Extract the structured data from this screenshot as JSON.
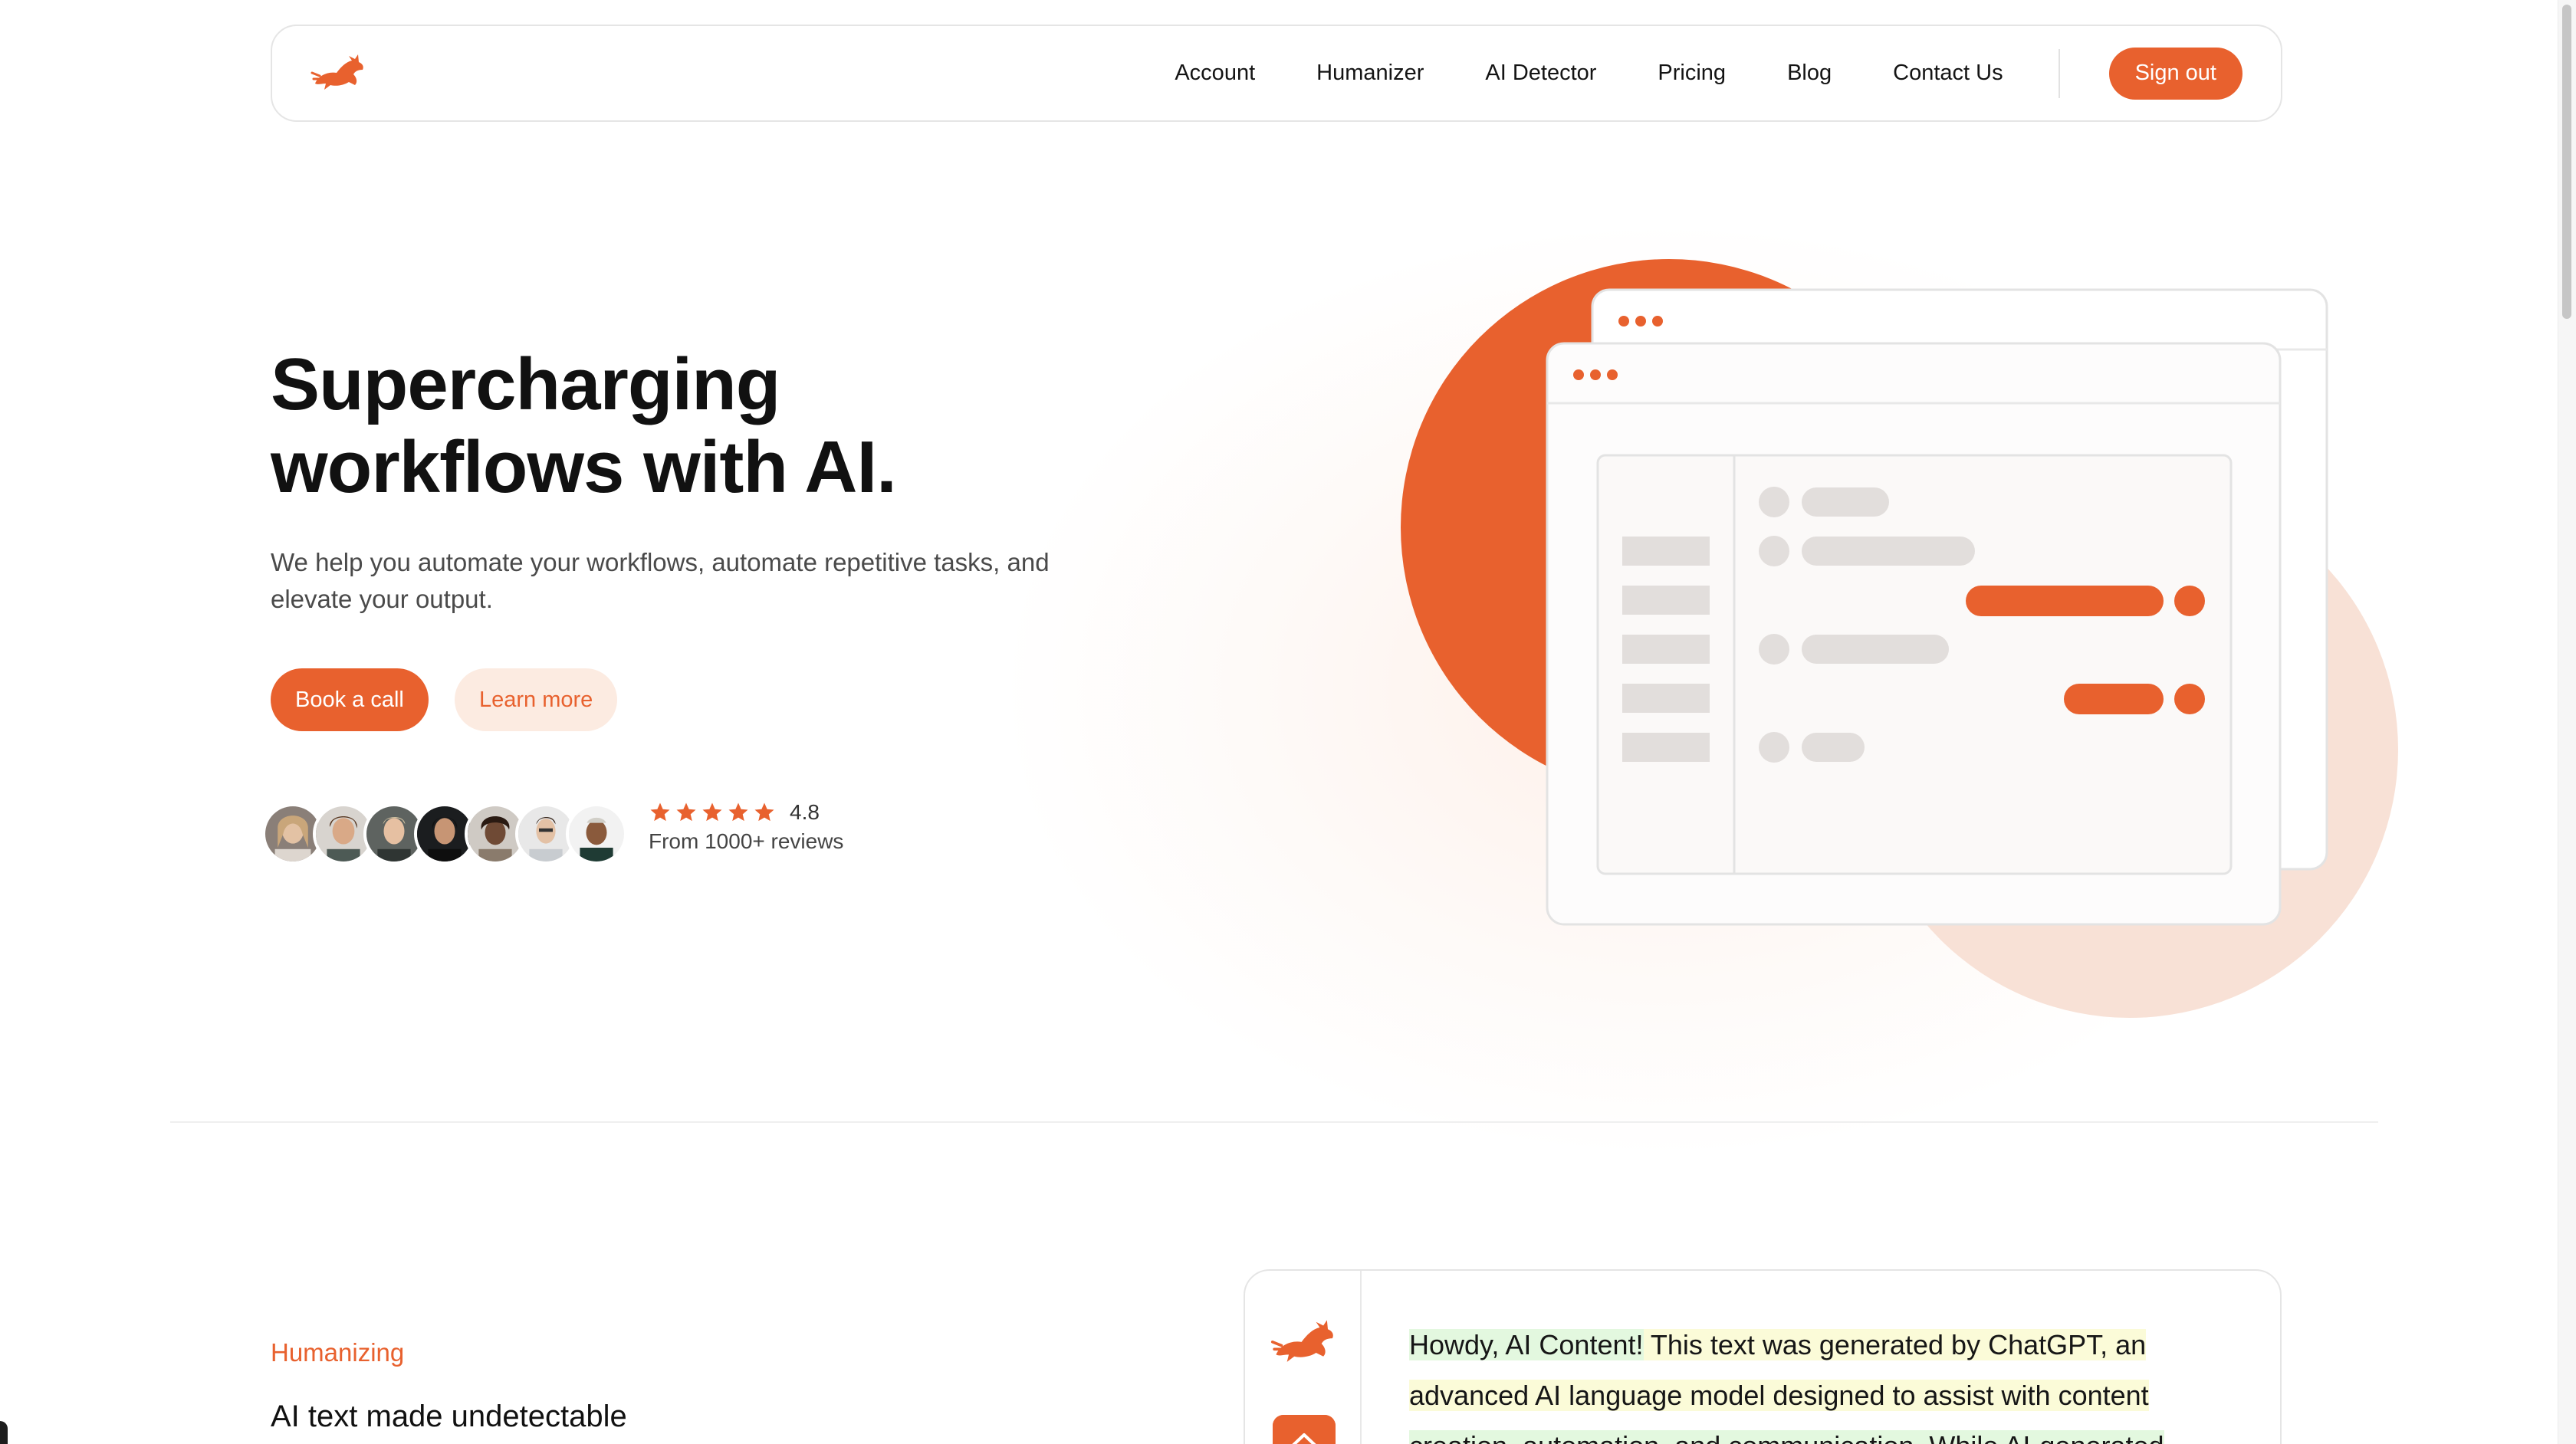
{
  "nav": {
    "links": [
      "Account",
      "Humanizer",
      "AI Detector",
      "Pricing",
      "Blog",
      "Contact Us"
    ],
    "signout_label": "Sign out"
  },
  "hero": {
    "title_line1": "Supercharging",
    "title_line2": "workflows with AI.",
    "subtitle": "We help you automate your workflows, automate repetitive tasks, and elevate your output.",
    "book_label": "Book a call",
    "learn_label": "Learn more",
    "rating_value": "4.8",
    "rating_stars": 5,
    "rating_sub": "From 1000+ reviews"
  },
  "section": {
    "eyebrow": "Humanizing",
    "title": "AI text made undetectable"
  },
  "demo": {
    "text_part1": "Howdy, AI Content!",
    "text_part2": " This text was generated by ChatGPT, an advanced AI language model designed to assist with content",
    "text_part3": "creation, automation, and communication. While AI-generated"
  },
  "colors": {
    "accent": "#e8612e",
    "accent_soft": "#fcebe1",
    "highlight_green": "#e3f8df",
    "highlight_yellow": "#fbfbd8"
  },
  "icons": [
    "rabbit-logo-icon",
    "star-icon",
    "home-icon"
  ]
}
